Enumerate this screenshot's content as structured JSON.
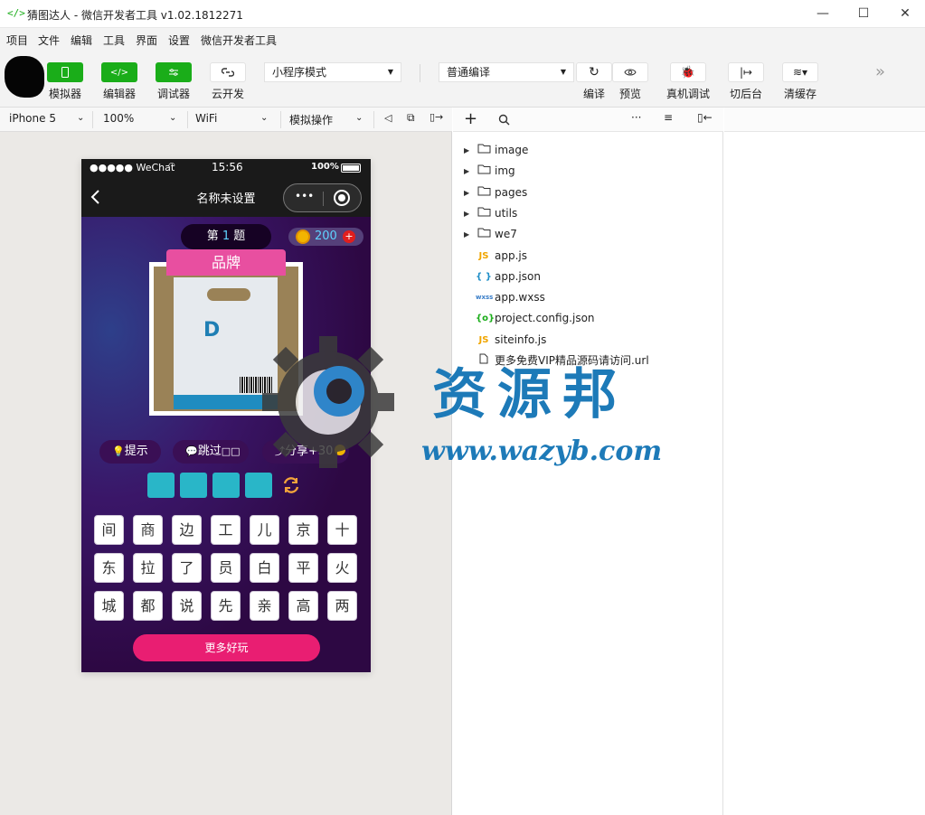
{
  "window": {
    "title": "猜图达人 - 微信开发者工具 v1.02.1812271",
    "logo": "</>",
    "minimize": "—",
    "maximize": "☐",
    "close": "✕"
  },
  "menu": [
    "项目",
    "文件",
    "编辑",
    "工具",
    "界面",
    "设置",
    "微信开发者工具"
  ],
  "toolbar": {
    "simulator": "模拟器",
    "editor": "编辑器",
    "debugger": "调试器",
    "cloud": "云开发",
    "mode": "小程序模式",
    "compile_mode": "普通编译",
    "compile": "编译",
    "preview": "预览",
    "remote_debug": "真机调试",
    "background": "切后台",
    "clear_cache": "清缓存",
    "more": "»"
  },
  "device_bar": {
    "device": "iPhone 5",
    "zoom": "100%",
    "network": "WiFi",
    "operation": "模拟操作"
  },
  "phone": {
    "carrier": "●●●●● WeChat",
    "time": "15:56",
    "battery": "100%",
    "nav_title": "名称未设置",
    "level": "第 1 题",
    "level_prefix": "第",
    "level_num": "1",
    "level_suffix": "题",
    "coins": "200",
    "category": "品牌",
    "logo_letter": "D",
    "hint": "提示",
    "skip": "跳过",
    "skip_glyph": "□□",
    "share": "分享+30",
    "keys": [
      "间",
      "商",
      "边",
      "工",
      "儿",
      "京",
      "十",
      "东",
      "拉",
      "了",
      "员",
      "白",
      "平",
      "火",
      "城",
      "都",
      "说",
      "先",
      "亲",
      "高",
      "两"
    ],
    "more_games": "更多好玩"
  },
  "files": [
    {
      "name": "image",
      "type": "folder"
    },
    {
      "name": "img",
      "type": "folder"
    },
    {
      "name": "pages",
      "type": "folder"
    },
    {
      "name": "utils",
      "type": "folder"
    },
    {
      "name": "we7",
      "type": "folder"
    },
    {
      "name": "app.js",
      "type": "js",
      "icon": "JS"
    },
    {
      "name": "app.json",
      "type": "json",
      "icon": "{ }"
    },
    {
      "name": "app.wxss",
      "type": "wxss",
      "icon": "wxss"
    },
    {
      "name": "project.config.json",
      "type": "config",
      "icon": "{o}"
    },
    {
      "name": "siteinfo.js",
      "type": "js",
      "icon": "JS"
    },
    {
      "name": "更多免费VIP精品源码请访问.url",
      "type": "url"
    }
  ],
  "watermark": {
    "title": "资源邦",
    "url": "www.wazyb.com"
  },
  "colors": {
    "accent_green": "#1aad19",
    "pink": "#e84fa0",
    "game_bg": "#2d0843",
    "teal": "#29b6c8",
    "more_btn": "#e91e72",
    "watermark_blue": "#1d7ab8"
  }
}
